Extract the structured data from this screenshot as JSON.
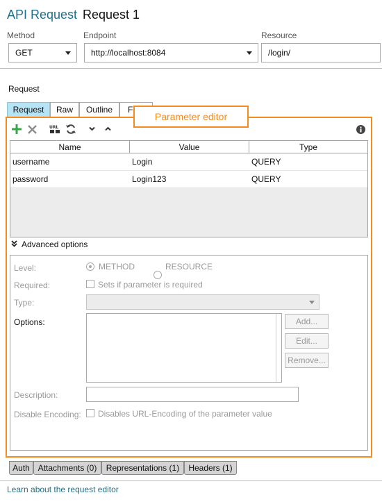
{
  "header": {
    "title_api": "API Request",
    "title_name": "Request 1"
  },
  "method": {
    "label": "Method",
    "value": "GET"
  },
  "endpoint": {
    "label": "Endpoint",
    "value": "http://localhost:8084"
  },
  "resource": {
    "label": "Resource",
    "value": "/login/"
  },
  "section_label": "Request",
  "tabs": [
    {
      "label": "Request"
    },
    {
      "label": "Raw"
    },
    {
      "label": "Outline"
    },
    {
      "label": "F"
    }
  ],
  "callout": "Parameter editor",
  "grid": {
    "columns": [
      "Name",
      "Value",
      "Type"
    ],
    "rows": [
      {
        "name": "username",
        "value": "Login",
        "type": "QUERY"
      },
      {
        "name": "password",
        "value": "Login123",
        "type": "QUERY"
      }
    ]
  },
  "advanced": {
    "toggle_label": "Advanced options",
    "level_label": "Level:",
    "level_method": "METHOD",
    "level_resource": "RESOURCE",
    "required_label": "Required:",
    "required_text": "Sets if parameter is required",
    "type_label": "Type:",
    "options_label": "Options:",
    "add_button": "Add...",
    "edit_button": "Edit...",
    "remove_button": "Remove...",
    "description_label": "Description:",
    "disable_encoding_label": "Disable Encoding:",
    "disable_encoding_text": "Disables URL-Encoding of the parameter value"
  },
  "bottom_tabs": [
    {
      "label": "Auth"
    },
    {
      "label": "Attachments (0)"
    },
    {
      "label": "Representations (1)"
    },
    {
      "label": "Headers (1)"
    }
  ],
  "footer_link": "Learn about the request editor",
  "colors": {
    "accent": "#1f6f8b",
    "callout": "#f28c1e",
    "active_tab": "#b6e4f4",
    "add_icon": "#3aa64a"
  },
  "icons": [
    "add-icon",
    "delete-icon",
    "url-encode-icon",
    "refresh-icon",
    "move-down-icon",
    "move-up-icon",
    "info-icon",
    "expand-icon"
  ]
}
